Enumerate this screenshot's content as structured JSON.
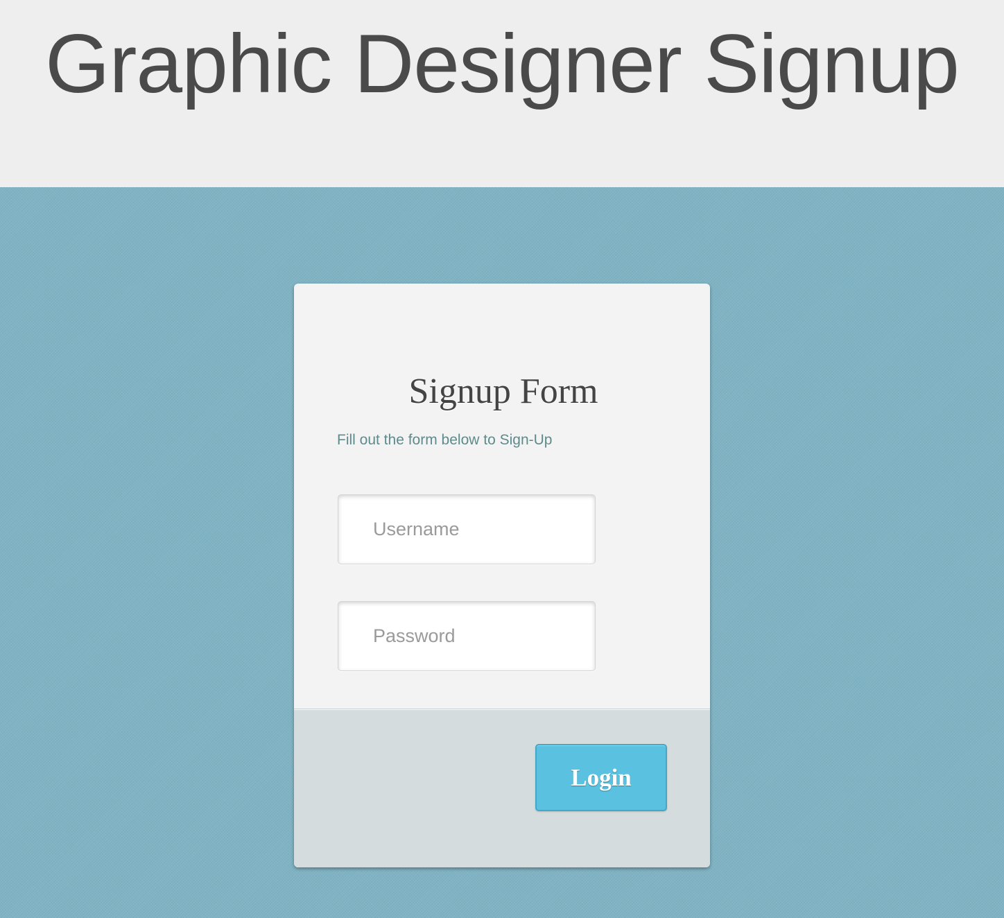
{
  "header": {
    "title": "Graphic Designer Signup"
  },
  "form": {
    "title": "Signup Form",
    "subtitle": "Fill out the form below to Sign-Up",
    "username_placeholder": "Username",
    "password_placeholder": "Password",
    "login_label": "Login"
  },
  "colors": {
    "page_background": "#80b3c4",
    "header_background": "#eeeeee",
    "button_background": "#5ac2e0",
    "subtitle_text": "#5f8a8b"
  }
}
